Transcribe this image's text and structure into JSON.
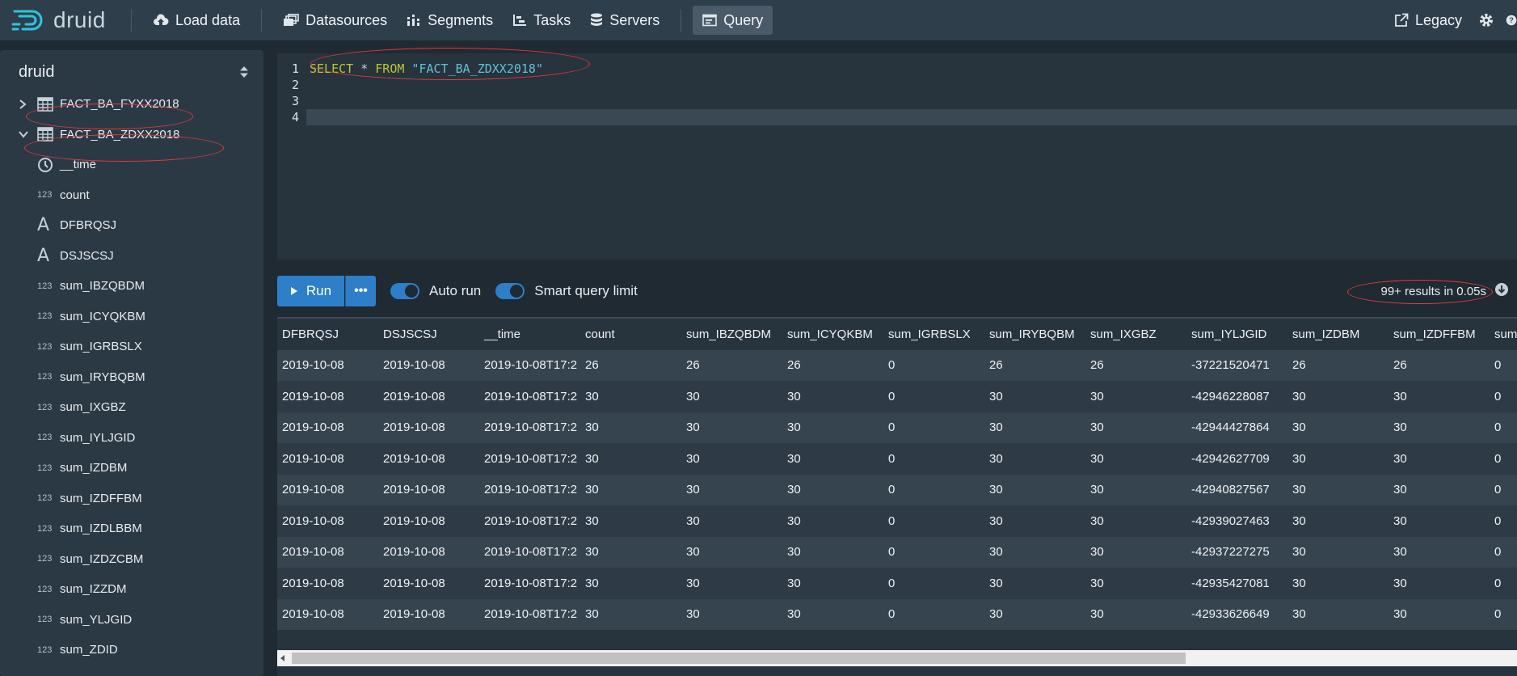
{
  "app": {
    "name": "druid"
  },
  "nav": {
    "items": [
      {
        "label": "Load data",
        "icon": "cloud-upload-icon"
      },
      {
        "label": "Datasources",
        "icon": "datasources-icon"
      },
      {
        "label": "Segments",
        "icon": "segments-icon"
      },
      {
        "label": "Tasks",
        "icon": "tasks-icon"
      },
      {
        "label": "Servers",
        "icon": "servers-icon"
      },
      {
        "label": "Query",
        "icon": "query-icon",
        "active": true
      }
    ],
    "legacy_label": "Legacy"
  },
  "sidebar": {
    "datasource_select": "druid",
    "tables": [
      {
        "name": "FACT_BA_FYXX2018",
        "expanded": false
      },
      {
        "name": "FACT_BA_ZDXX2018",
        "expanded": true
      }
    ],
    "columns": [
      {
        "name": "__time",
        "type_icon": "clock-icon"
      },
      {
        "name": "count",
        "type_icon": "123"
      },
      {
        "name": "DFBRQSJ",
        "type_icon": "A"
      },
      {
        "name": "DSJSCSJ",
        "type_icon": "A"
      },
      {
        "name": "sum_IBZQBDM",
        "type_icon": "123"
      },
      {
        "name": "sum_ICYQKBM",
        "type_icon": "123"
      },
      {
        "name": "sum_IGRBSLX",
        "type_icon": "123"
      },
      {
        "name": "sum_IRYBQBM",
        "type_icon": "123"
      },
      {
        "name": "sum_IXGBZ",
        "type_icon": "123"
      },
      {
        "name": "sum_IYLJGID",
        "type_icon": "123"
      },
      {
        "name": "sum_IZDBM",
        "type_icon": "123"
      },
      {
        "name": "sum_IZDFFBM",
        "type_icon": "123"
      },
      {
        "name": "sum_IZDLBBM",
        "type_icon": "123"
      },
      {
        "name": "sum_IZDZCBM",
        "type_icon": "123"
      },
      {
        "name": "sum_IZZDM",
        "type_icon": "123"
      },
      {
        "name": "sum_YLJGID",
        "type_icon": "123"
      },
      {
        "name": "sum_ZDID",
        "type_icon": "123"
      }
    ]
  },
  "editor": {
    "lines": [
      {
        "number": "1",
        "keyword1": "SELECT",
        "op": " * ",
        "keyword2": "FROM",
        "string": " \"FACT_BA_ZDXX2018\""
      },
      {
        "number": "2"
      },
      {
        "number": "3"
      },
      {
        "number": "4"
      }
    ]
  },
  "controls": {
    "run_label": "Run",
    "more_label": "•••",
    "auto_run_label": "Auto run",
    "auto_run_on": true,
    "smart_limit_label": "Smart query limit",
    "smart_limit_on": true,
    "results_info": "99+ results in 0.05s"
  },
  "results": {
    "columns": [
      "DFBRQSJ",
      "DSJSCSJ",
      "__time",
      "count",
      "sum_IBZQBDM",
      "sum_ICYQKBM",
      "sum_IGRBSLX",
      "sum_IRYBQBM",
      "sum_IXGBZ",
      "sum_IYLJGID",
      "sum_IZDBM",
      "sum_IZDFFBM",
      "sum"
    ],
    "rows": [
      [
        "2019-10-08",
        "2019-10-08",
        "2019-10-08T17:2",
        "26",
        "26",
        "26",
        "0",
        "26",
        "26",
        "-37221520471",
        "26",
        "26",
        "0"
      ],
      [
        "2019-10-08",
        "2019-10-08",
        "2019-10-08T17:2",
        "30",
        "30",
        "30",
        "0",
        "30",
        "30",
        "-42946228087",
        "30",
        "30",
        "0"
      ],
      [
        "2019-10-08",
        "2019-10-08",
        "2019-10-08T17:2",
        "30",
        "30",
        "30",
        "0",
        "30",
        "30",
        "-42944427864",
        "30",
        "30",
        "0"
      ],
      [
        "2019-10-08",
        "2019-10-08",
        "2019-10-08T17:2",
        "30",
        "30",
        "30",
        "0",
        "30",
        "30",
        "-42942627709",
        "30",
        "30",
        "0"
      ],
      [
        "2019-10-08",
        "2019-10-08",
        "2019-10-08T17:2",
        "30",
        "30",
        "30",
        "0",
        "30",
        "30",
        "-42940827567",
        "30",
        "30",
        "0"
      ],
      [
        "2019-10-08",
        "2019-10-08",
        "2019-10-08T17:2",
        "30",
        "30",
        "30",
        "0",
        "30",
        "30",
        "-42939027463",
        "30",
        "30",
        "0"
      ],
      [
        "2019-10-08",
        "2019-10-08",
        "2019-10-08T17:2",
        "30",
        "30",
        "30",
        "0",
        "30",
        "30",
        "-42937227275",
        "30",
        "30",
        "0"
      ],
      [
        "2019-10-08",
        "2019-10-08",
        "2019-10-08T17:2",
        "30",
        "30",
        "30",
        "0",
        "30",
        "30",
        "-42935427081",
        "30",
        "30",
        "0"
      ],
      [
        "2019-10-08",
        "2019-10-08",
        "2019-10-08T17:2",
        "30",
        "30",
        "30",
        "0",
        "30",
        "30",
        "-42933626649",
        "30",
        "30",
        "0"
      ]
    ]
  },
  "colors": {
    "accent": "#2d7fc9",
    "navbar": "#2f3e4b",
    "annotation": "#e03a3a"
  }
}
